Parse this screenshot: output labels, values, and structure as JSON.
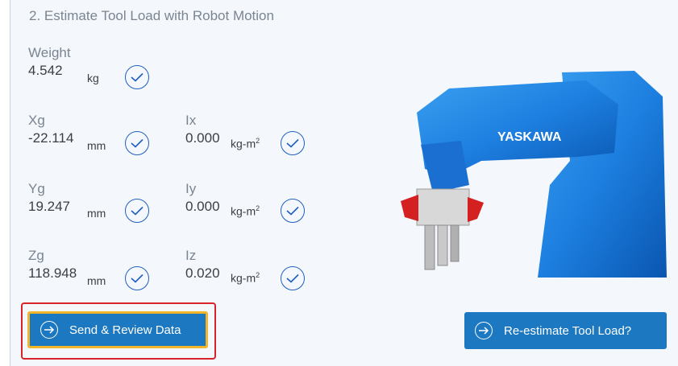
{
  "section": {
    "title": "2. Estimate Tool Load with Robot Motion"
  },
  "fields": {
    "weight": {
      "label": "Weight",
      "value": "4.542",
      "unit": "kg"
    },
    "xg": {
      "label": "Xg",
      "value": "-22.114",
      "unit": "mm"
    },
    "yg": {
      "label": "Yg",
      "value": "19.247",
      "unit": "mm"
    },
    "zg": {
      "label": "Zg",
      "value": "118.948",
      "unit": "mm"
    },
    "ix": {
      "label": "Ix",
      "value": "0.000",
      "unit": "kg-m",
      "unit_sup": "2"
    },
    "iy": {
      "label": "Iy",
      "value": "0.000",
      "unit": "kg-m",
      "unit_sup": "2"
    },
    "iz": {
      "label": "Iz",
      "value": "0.020",
      "unit": "kg-m",
      "unit_sup": "2"
    }
  },
  "robot": {
    "brand": "YASKAWA"
  },
  "buttons": {
    "send": "Send & Review Data",
    "reestimate": "Re-estimate Tool Load?"
  },
  "colors": {
    "accent": "#1c78c0",
    "check": "#1f5fbf",
    "highlight": "#d9232a",
    "focus": "#f2b62a"
  }
}
